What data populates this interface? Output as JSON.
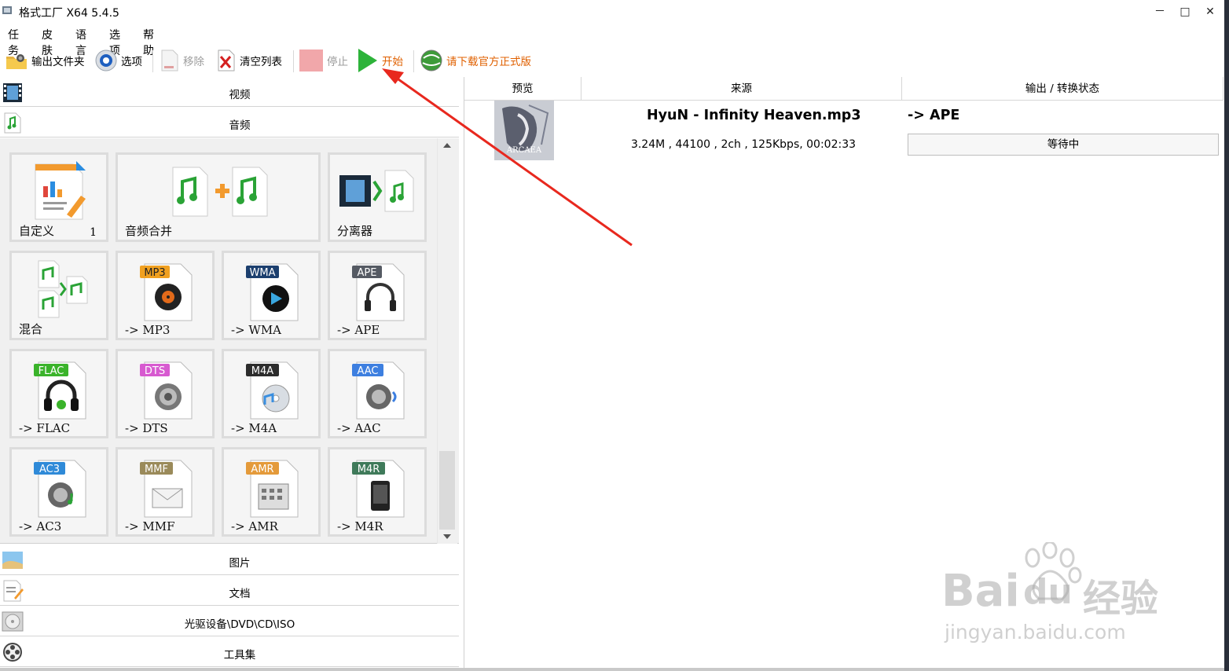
{
  "window": {
    "title": "格式工厂 X64 5.4.5",
    "minimize": "－",
    "maximize": "□",
    "close": "✕"
  },
  "menu": [
    "任务",
    "皮肤",
    "语言",
    "选项",
    "帮助"
  ],
  "toolbar": {
    "output_folder": "输出文件夹",
    "options": "选项",
    "remove": "移除",
    "clear_list": "清空列表",
    "stop": "停止",
    "start": "开始",
    "download": "请下载官方正式版",
    "download_color": "#e06000"
  },
  "categories": {
    "video": "视频",
    "audio": "音频",
    "picture": "图片",
    "document": "文档",
    "disc": "光驱设备\\DVD\\CD\\ISO",
    "tools": "工具集"
  },
  "tiles": [
    {
      "label": "自定义",
      "count": "1",
      "icon": "custom-chart-icon"
    },
    {
      "label": "音频合并",
      "icon": "audio-merge-icon"
    },
    {
      "label": "分离器",
      "icon": "splitter-icon"
    },
    {
      "label": "混合",
      "icon": "mix-icon"
    },
    {
      "label": "-> MP3",
      "badge": "MP3",
      "badge_color": "#f0a020",
      "icon": "mp3-disc-icon"
    },
    {
      "label": "-> WMA",
      "badge": "WMA",
      "badge_color": "#1c3f6e",
      "icon": "wma-icon"
    },
    {
      "label": "-> APE",
      "badge": "APE",
      "badge_color": "#555a63",
      "icon": "ape-headphone-icon"
    },
    {
      "label": "-> FLAC",
      "badge": "FLAC",
      "badge_color": "#3ab32a",
      "icon": "flac-headphone-icon"
    },
    {
      "label": "-> DTS",
      "badge": "DTS",
      "badge_color": "#d75ad0",
      "icon": "dts-speaker-icon"
    },
    {
      "label": "-> M4A",
      "badge": "M4A",
      "badge_color": "#2c2c2c",
      "icon": "m4a-cd-icon"
    },
    {
      "label": "-> AAC",
      "badge": "AAC",
      "badge_color": "#3d7fe0",
      "icon": "aac-speaker-icon"
    },
    {
      "label": "-> AC3",
      "badge": "AC3",
      "badge_color": "#2f8ad8",
      "icon": "ac3-speaker-icon"
    },
    {
      "label": "-> MMF",
      "badge": "MMF",
      "badge_color": "#9a8a5a",
      "icon": "mmf-envelope-icon"
    },
    {
      "label": "-> AMR",
      "badge": "AMR",
      "badge_color": "#e49a3a",
      "icon": "amr-keypad-icon"
    },
    {
      "label": "-> M4R",
      "badge": "M4R",
      "badge_color": "#3f7a5a",
      "icon": "m4r-phone-icon"
    }
  ],
  "table": {
    "headers": [
      "预览",
      "来源",
      "输出 / 转换状态"
    ],
    "row": {
      "source_name": "HyuN - Infinity Heaven.mp3",
      "source_meta": "3.24M , 44100 , 2ch , 125Kbps, 00:02:33",
      "output": "-> APE",
      "status": "等待中",
      "thumb_text": "ARCAEA"
    }
  },
  "watermark": {
    "brand": "Bai",
    "brand2": "du",
    "brand_cn": "经验",
    "url": "jingyan.baidu.com"
  },
  "annotation_color": "#e8281e"
}
